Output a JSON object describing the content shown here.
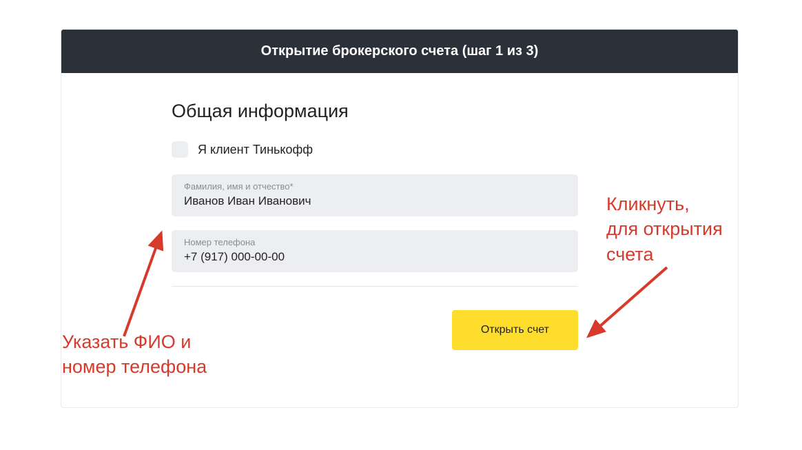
{
  "header": {
    "title": "Открытие брокерского счета (шаг 1 из 3)"
  },
  "section": {
    "title": "Общая информация"
  },
  "checkbox": {
    "label": "Я клиент Тинькофф"
  },
  "fields": {
    "fullname": {
      "label": "Фамилия, имя и отчество*",
      "value": "Иванов Иван Иванович"
    },
    "phone": {
      "label": "Номер телефона",
      "value": "+7 (917) 000-00-00"
    }
  },
  "button": {
    "label": "Открыть счет"
  },
  "annotations": {
    "left": "Указать ФИО и\nномер телефона",
    "right": "Кликнуть,\nдля открытия\nсчета"
  }
}
